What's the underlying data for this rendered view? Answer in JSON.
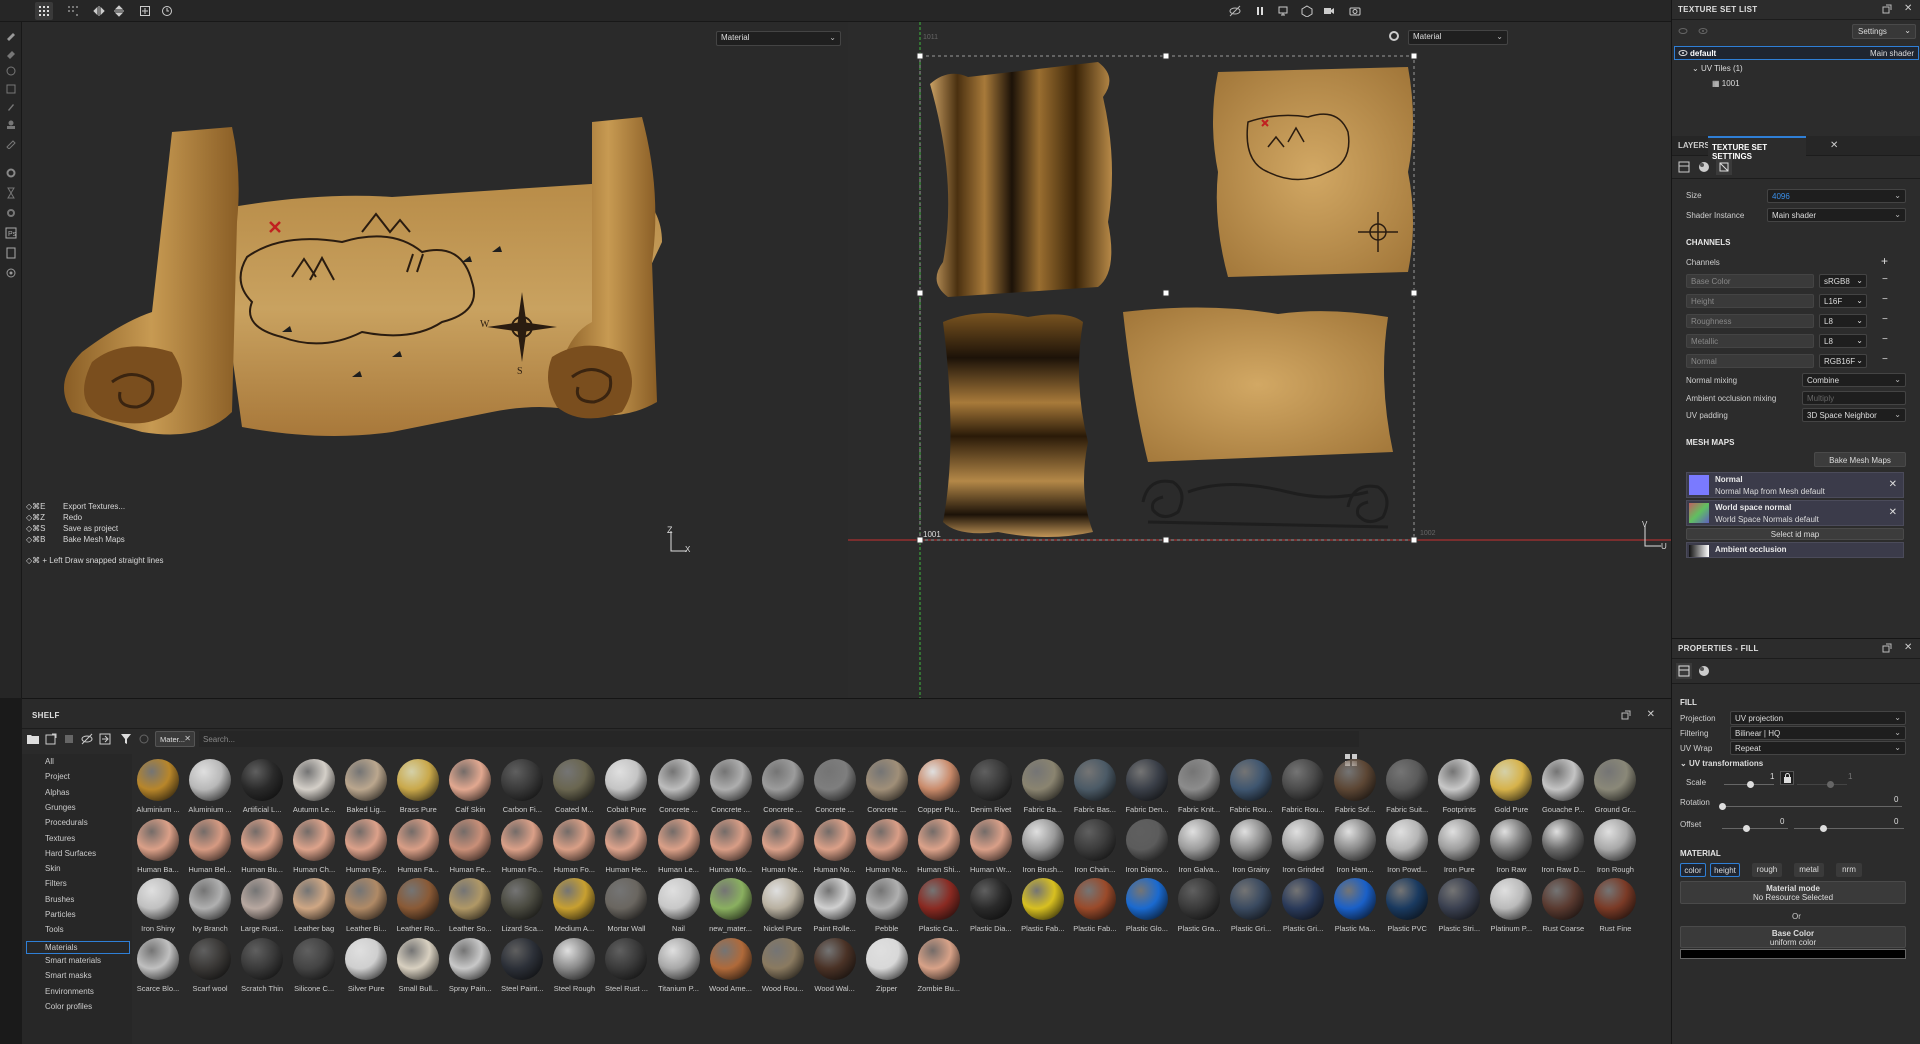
{
  "viewport3d": {
    "material_dropdown": "Material",
    "shortcuts": [
      {
        "keys": "◇⌘E",
        "action": "Export Textures..."
      },
      {
        "keys": "◇⌘Z",
        "action": "Redo"
      },
      {
        "keys": "◇⌘S",
        "action": "Save as project"
      },
      {
        "keys": "◇⌘B",
        "action": "Bake Mesh Maps"
      }
    ],
    "hint": "◇⌘ + Left  Draw snapped straight lines",
    "axis_z": "Z",
    "axis_x": "X",
    "map_letters": [
      "W",
      "S"
    ]
  },
  "viewport2d": {
    "material_dropdown": "Material",
    "tile_label": "1001",
    "tile_label_top": "1011",
    "tile_label_right": "1002",
    "axis_v": "V",
    "axis_u": "U"
  },
  "texture_set_list": {
    "title": "TEXTURE SET LIST",
    "settings_label": "Settings",
    "set_name": "default",
    "shader": "Main shader",
    "uv_tiles": "UV Tiles (1)",
    "tile": "1001"
  },
  "tabs": {
    "layers": "LAYERS",
    "texture_set_settings": "TEXTURE SET SETTINGS"
  },
  "tss": {
    "size_label": "Size",
    "size_value": "4096",
    "shader_instance_label": "Shader Instance",
    "shader_instance_value": "Main shader",
    "channels_header": "CHANNELS",
    "channels_label": "Channels",
    "channels": [
      {
        "name": "Base Color",
        "format": "sRGB8"
      },
      {
        "name": "Height",
        "format": "L16F"
      },
      {
        "name": "Roughness",
        "format": "L8"
      },
      {
        "name": "Metallic",
        "format": "L8"
      },
      {
        "name": "Normal",
        "format": "RGB16F"
      }
    ],
    "normal_mixing_label": "Normal mixing",
    "normal_mixing_value": "Combine",
    "ao_mixing_label": "Ambient occlusion mixing",
    "ao_mixing_value": "Multiply",
    "uv_padding_label": "UV padding",
    "uv_padding_value": "3D Space Neighbor",
    "mesh_maps_header": "MESH MAPS",
    "bake_button": "Bake Mesh Maps",
    "mesh_maps": [
      {
        "title": "Normal",
        "subtitle": "Normal Map from Mesh default"
      },
      {
        "title": "World space normal",
        "subtitle": "World Space Normals default"
      }
    ],
    "select_id_map": "Select id map",
    "ambient_occlusion": "Ambient occlusion"
  },
  "properties": {
    "title": "PROPERTIES - FILL",
    "fill_header": "FILL",
    "projection_label": "Projection",
    "projection_value": "UV projection",
    "filtering_label": "Filtering",
    "filtering_value": "Bilinear | HQ",
    "uvwrap_label": "UV Wrap",
    "uvwrap_value": "Repeat",
    "uv_transformations": "UV transformations",
    "scale_label": "Scale",
    "scale_value": "1",
    "scale_value2": "1",
    "rotation_label": "Rotation",
    "rotation_value": "0",
    "offset_label": "Offset",
    "offset_value1": "0",
    "offset_value2": "0",
    "material_header": "MATERIAL",
    "material_tabs": [
      "color",
      "height",
      "rough",
      "metal",
      "nrm"
    ],
    "material_mode": "Material mode",
    "no_resource": "No Resource Selected",
    "or": "Or",
    "base_color": "Base Color",
    "uniform_color": "uniform color"
  },
  "shelf": {
    "title": "SHELF",
    "filter_chip": "Mater...",
    "search_placeholder": "Search...",
    "categories": [
      "All",
      "Project",
      "Alphas",
      "Grunges",
      "Procedurals",
      "Textures",
      "Hard Surfaces",
      "Skin",
      "Filters",
      "Brushes",
      "Particles",
      "Tools",
      "Materials",
      "Smart materials",
      "Smart masks",
      "Environments",
      "Color profiles"
    ],
    "selected_category": "Materials",
    "materials": [
      {
        "name": "Aluminium ...",
        "color": "#b8862a",
        "type": "orange"
      },
      {
        "name": "Aluminium ...",
        "color": "#b8b8b8",
        "type": "metal"
      },
      {
        "name": "Artificial L...",
        "color": "#2a2a2a",
        "type": "dark"
      },
      {
        "name": "Autumn Le...",
        "color": "#d4cfc8",
        "type": "leaf"
      },
      {
        "name": "Baked Lig...",
        "color": "#bba78e",
        "type": "matte"
      },
      {
        "name": "Brass Pure",
        "color": "#c9a84a",
        "type": "gold"
      },
      {
        "name": "Calf Skin",
        "color": "#e2a890",
        "type": "skin"
      },
      {
        "name": "Carbon Fi...",
        "color": "#3a3a3a",
        "type": "dark"
      },
      {
        "name": "Coated M...",
        "color": "#6a6650",
        "type": "matte"
      },
      {
        "name": "Cobalt Pure",
        "color": "#c4c4c4",
        "type": "metal"
      },
      {
        "name": "Concrete ...",
        "color": "#bdbdbd",
        "type": "matte"
      },
      {
        "name": "Concrete ...",
        "color": "#aeaeae",
        "type": "matte"
      },
      {
        "name": "Concrete ...",
        "color": "#9c9c9c",
        "type": "matte"
      },
      {
        "name": "Concrete ...",
        "color": "#7e7e7e",
        "type": "matte"
      },
      {
        "name": "Concrete ...",
        "color": "#a08f78",
        "type": "matte"
      },
      {
        "name": "Copper Pu...",
        "color": "#c98a6a",
        "type": "metal"
      },
      {
        "name": "Denim Rivet",
        "color": "#3a3a3a",
        "type": "dark"
      },
      {
        "name": "Fabric Ba...",
        "color": "#8a8470",
        "type": "matte"
      },
      {
        "name": "Fabric Bas...",
        "color": "#4b5a66",
        "type": "matte"
      },
      {
        "name": "Fabric Den...",
        "color": "#3a3f48",
        "type": "matte"
      },
      {
        "name": "Fabric Knit...",
        "color": "#8c8c8c",
        "type": "matte"
      },
      {
        "name": "Fabric Rou...",
        "color": "#3f5670",
        "type": "matte"
      },
      {
        "name": "Fabric Rou...",
        "color": "#4a4a4a",
        "type": "matte"
      },
      {
        "name": "Fabric Sof...",
        "color": "#5c4634",
        "type": "matte"
      },
      {
        "name": "Fabric Suit...",
        "color": "#5a5a5a",
        "type": "matte"
      },
      {
        "name": "Footprints",
        "color": "#c8c8c8",
        "type": "matte"
      },
      {
        "name": "Gold Pure",
        "color": "#d6b24a",
        "type": "gold"
      },
      {
        "name": "Gouache P...",
        "color": "#c4c4c4",
        "type": "matte"
      },
      {
        "name": "Ground Gr...",
        "color": "#8a8878",
        "type": "matte"
      },
      {
        "name": "Human Ba...",
        "color": "#dba088",
        "type": "skin"
      },
      {
        "name": "Human Bel...",
        "color": "#d69a82",
        "type": "skin"
      },
      {
        "name": "Human Bu...",
        "color": "#dca28a",
        "type": "skin"
      },
      {
        "name": "Human Ch...",
        "color": "#dda38b",
        "type": "skin"
      },
      {
        "name": "Human Ey...",
        "color": "#dca18a",
        "type": "skin"
      },
      {
        "name": "Human Fa...",
        "color": "#d99e86",
        "type": "skin"
      },
      {
        "name": "Human Fe...",
        "color": "#c98f78",
        "type": "skin"
      },
      {
        "name": "Human Fo...",
        "color": "#dba088",
        "type": "skin"
      },
      {
        "name": "Human Fo...",
        "color": "#d99f86",
        "type": "skin"
      },
      {
        "name": "Human He...",
        "color": "#dda38c",
        "type": "skin"
      },
      {
        "name": "Human Le...",
        "color": "#dba088",
        "type": "skin"
      },
      {
        "name": "Human Mo...",
        "color": "#d89d86",
        "type": "skin"
      },
      {
        "name": "Human Ne...",
        "color": "#dba18a",
        "type": "skin"
      },
      {
        "name": "Human No...",
        "color": "#dba088",
        "type": "skin"
      },
      {
        "name": "Human No...",
        "color": "#d99e87",
        "type": "skin"
      },
      {
        "name": "Human Shi...",
        "color": "#dca28a",
        "type": "skin"
      },
      {
        "name": "Human Wr...",
        "color": "#d99f88",
        "type": "skin"
      },
      {
        "name": "Iron Brush...",
        "color": "#9a9a9a",
        "type": "metal"
      },
      {
        "name": "Iron Chain...",
        "color": "#3c3c3c",
        "type": "dark"
      },
      {
        "name": "Iron Diamo...",
        "color": "#5c5c5c",
        "type": "dark"
      },
      {
        "name": "Iron Galva...",
        "color": "#9c9c9c",
        "type": "metal"
      },
      {
        "name": "Iron Grainy",
        "color": "#8c8c8c",
        "type": "metal"
      },
      {
        "name": "Iron Grinded",
        "color": "#a4a4a4",
        "type": "metal"
      },
      {
        "name": "Iron Ham...",
        "color": "#8a8a8a",
        "type": "metal"
      },
      {
        "name": "Iron Powd...",
        "color": "#b4b4b4",
        "type": "metal"
      },
      {
        "name": "Iron Pure",
        "color": "#9e9e9e",
        "type": "metal"
      },
      {
        "name": "Iron Raw",
        "color": "#7a7a7a",
        "type": "metal"
      },
      {
        "name": "Iron Raw D...",
        "color": "#6a6a6a",
        "type": "metal"
      },
      {
        "name": "Iron Rough",
        "color": "#a8a8a8",
        "type": "metal"
      },
      {
        "name": "Iron Shiny",
        "color": "#c0c0c0",
        "type": "metal"
      },
      {
        "name": "Ivy Branch",
        "color": "#b0b0b0",
        "type": "matte"
      },
      {
        "name": "Large Rust...",
        "color": "#b8a8a0",
        "type": "matte"
      },
      {
        "name": "Leather bag",
        "color": "#cfa784",
        "type": "matte"
      },
      {
        "name": "Leather Bi...",
        "color": "#b08a66",
        "type": "matte"
      },
      {
        "name": "Leather Ro...",
        "color": "#8a5a36",
        "type": "matte"
      },
      {
        "name": "Leather So...",
        "color": "#b09866",
        "type": "matte"
      },
      {
        "name": "Lizard Sca...",
        "color": "#4a4a40",
        "type": "matte"
      },
      {
        "name": "Medium A...",
        "color": "#c8a030",
        "type": "matte"
      },
      {
        "name": "Mortar Wall",
        "color": "#6a6660",
        "type": "matte"
      },
      {
        "name": "Nail",
        "color": "#c8c8c8",
        "type": "metal"
      },
      {
        "name": "new_mater...",
        "color": "#8ab060",
        "type": "matte"
      },
      {
        "name": "Nickel Pure",
        "color": "#b8b0a0",
        "type": "metal"
      },
      {
        "name": "Paint Rolle...",
        "color": "#d0d0d0",
        "type": "matte"
      },
      {
        "name": "Pebble",
        "color": "#b0b0b0",
        "type": "matte"
      },
      {
        "name": "Plastic Ca...",
        "color": "#8a2a22",
        "type": "matte"
      },
      {
        "name": "Plastic Dia...",
        "color": "#2a2a2a",
        "type": "dark"
      },
      {
        "name": "Plastic Fab...",
        "color": "#d8c020",
        "type": "matte"
      },
      {
        "name": "Plastic Fab...",
        "color": "#9a4a2a",
        "type": "matte"
      },
      {
        "name": "Plastic Glo...",
        "color": "#1a6ad0",
        "type": "matte"
      },
      {
        "name": "Plastic Gra...",
        "color": "#3a3a3a",
        "type": "dark"
      },
      {
        "name": "Plastic Gri...",
        "color": "#3a4a60",
        "type": "matte"
      },
      {
        "name": "Plastic Gri...",
        "color": "#2a3a5a",
        "type": "matte"
      },
      {
        "name": "Plastic Ma...",
        "color": "#1a60c8",
        "type": "matte"
      },
      {
        "name": "Plastic PVC",
        "color": "#1a3a60",
        "type": "matte"
      },
      {
        "name": "Plastic Stri...",
        "color": "#3a4050",
        "type": "matte"
      },
      {
        "name": "Platinum P...",
        "color": "#bababa",
        "type": "metal"
      },
      {
        "name": "Rust Coarse",
        "color": "#5a3a30",
        "type": "matte"
      },
      {
        "name": "Rust Fine",
        "color": "#7a3a26",
        "type": "matte"
      },
      {
        "name": "Scarce Blo...",
        "color": "#c0c0c0",
        "type": "matte"
      },
      {
        "name": "Scarf wool",
        "color": "#3a3836",
        "type": "dark"
      },
      {
        "name": "Scratch Thin",
        "color": "#3a3a3a",
        "type": "dark"
      },
      {
        "name": "Silicone C...",
        "color": "#444444",
        "type": "dark"
      },
      {
        "name": "Silver Pure",
        "color": "#cfcfcf",
        "type": "metal"
      },
      {
        "name": "Small Bull...",
        "color": "#d8d0c0",
        "type": "matte"
      },
      {
        "name": "Spray Pain...",
        "color": "#c8c8c8",
        "type": "matte"
      },
      {
        "name": "Steel Paint...",
        "color": "#2c3038",
        "type": "dark"
      },
      {
        "name": "Steel Rough",
        "color": "#8a8a8a",
        "type": "metal"
      },
      {
        "name": "Steel Rust ...",
        "color": "#3a3a3a",
        "type": "dark"
      },
      {
        "name": "Titanium P...",
        "color": "#a8a8a8",
        "type": "metal"
      },
      {
        "name": "Wood Ame...",
        "color": "#b06a3a",
        "type": "matte"
      },
      {
        "name": "Wood Rou...",
        "color": "#8a7a60",
        "type": "matte"
      },
      {
        "name": "Wood Wal...",
        "color": "#4a3226",
        "type": "matte"
      },
      {
        "name": "Zipper",
        "color": "#d8d8d8",
        "type": "metal"
      },
      {
        "name": "Zombie Bu...",
        "color": "#d8a288",
        "type": "skin"
      }
    ]
  },
  "colors": {
    "accent_blue": "#2f7fd6",
    "panel_bg": "#2c2c2c",
    "viewport_bg": "#2a2a2a",
    "parchment": "#c49a52"
  }
}
